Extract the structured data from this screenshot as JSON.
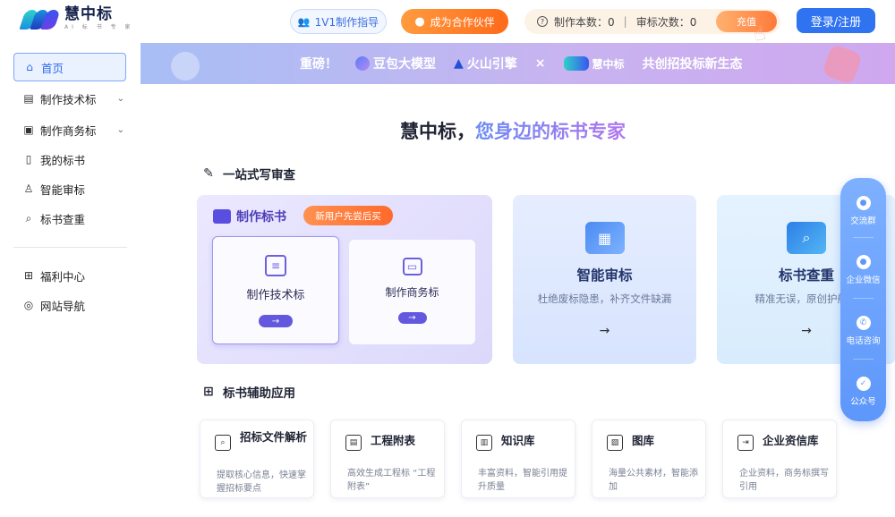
{
  "header": {
    "logo_title": "慧中标",
    "logo_sub": "AI 标 书 专 家",
    "guide_label": "1V1制作指导",
    "partner_label": "成为合作伙伴",
    "quota_make": "制作本数：0",
    "quota_review": "审标次数：0",
    "recharge_label": "充值",
    "login_label": "登录/注册"
  },
  "sidebar": {
    "items": [
      {
        "label": "首页",
        "icon": "home-icon",
        "active": true
      },
      {
        "label": "制作技术标",
        "icon": "doc-icon",
        "expandable": true
      },
      {
        "label": "制作商务标",
        "icon": "briefcase-icon",
        "expandable": true
      },
      {
        "label": "我的标书",
        "icon": "file-icon"
      },
      {
        "label": "智能审标",
        "icon": "user-check-icon"
      },
      {
        "label": "标书查重",
        "icon": "search-doc-icon"
      },
      {
        "label": "福利中心",
        "icon": "gift-icon"
      },
      {
        "label": "网站导航",
        "icon": "compass-icon"
      }
    ]
  },
  "banner": {
    "lead": "重磅！",
    "doubao": "豆包大模型",
    "volcano": "火山引擎",
    "times": "×",
    "brand": "慧中标",
    "tail": "共创招投标新生态"
  },
  "main": {
    "slogan_main": "慧中标，",
    "slogan_grad": "您身边的标书专家",
    "section_one": "一站式写审查",
    "section_two": "标书辅助应用",
    "make_card": {
      "title": "制作标书",
      "badge": "新用户先尝后买",
      "tech_label": "制作技术标",
      "biz_label": "制作商务标",
      "arrow": "→"
    },
    "audit_card": {
      "title": "智能审标",
      "desc": "杜绝废标隐患，补齐文件缺漏",
      "arrow": "→"
    },
    "check_card": {
      "title": "标书查重",
      "desc": "精准无误，原创护航标",
      "arrow": "→"
    },
    "tools": [
      {
        "title": "招标文件解析",
        "desc": "提取核心信息，快速掌握招标要点",
        "icon": "doc-search-icon"
      },
      {
        "title": "工程附表",
        "desc": "高效生成工程标 “工程附表”",
        "icon": "table-icon"
      },
      {
        "title": "知识库",
        "desc": "丰富资料，智能引用提升质量",
        "icon": "book-icon"
      },
      {
        "title": "图库",
        "desc": "海量公共素材，智能添加",
        "icon": "image-icon"
      },
      {
        "title": "企业资信库",
        "desc": "企业资料，商务标撰写引用",
        "icon": "upload-doc-icon"
      }
    ]
  },
  "float_bar": {
    "items": [
      {
        "label": "交流群",
        "icon": "chat-icon"
      },
      {
        "label": "企业微信",
        "icon": "wechat-work-icon"
      },
      {
        "label": "电话咨询",
        "icon": "phone-icon"
      },
      {
        "label": "公众号",
        "icon": "official-account-icon"
      }
    ]
  },
  "colors": {
    "accent": "#2f73f1",
    "purple": "#6458de",
    "orange": "#ff6a1a"
  }
}
